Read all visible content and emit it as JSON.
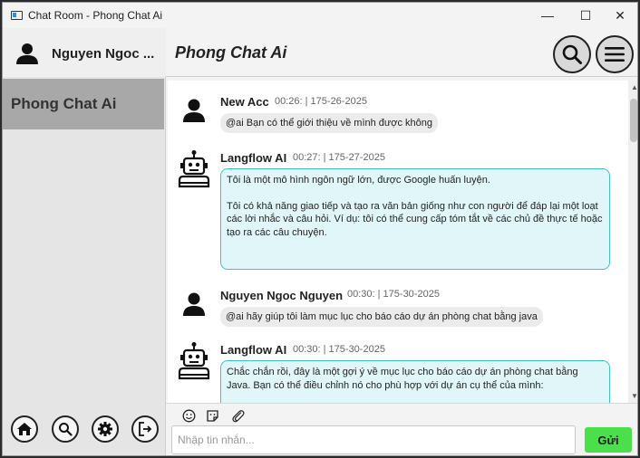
{
  "window": {
    "title": "Chat Room - Phong Chat Ai",
    "controls": {
      "minimize": "—",
      "maximize": "☐",
      "close": "✕"
    }
  },
  "sidebar": {
    "user_name": "Nguyen Ngoc ...",
    "rooms": [
      {
        "label": "Phong Chat Ai",
        "selected": true
      }
    ],
    "bottom_icons": [
      "home-icon",
      "search-icon",
      "gear-icon",
      "logout-icon"
    ]
  },
  "header": {
    "room_title": "Phong Chat Ai",
    "icons": [
      "search-icon",
      "menu-icon"
    ]
  },
  "messages": [
    {
      "sender": "New Acc",
      "time": "00:26: | 175-26-2025",
      "type": "user",
      "text": "@ai Bạn có thể giới thiệu về mình được không"
    },
    {
      "sender": "Langflow AI",
      "time": "00:27: | 175-27-2025",
      "type": "ai",
      "paragraphs": [
        "Tôi là một mô hình ngôn ngữ lớn, được Google huấn luyện.",
        "Tôi có khả năng giao tiếp và tạo ra văn bản giống như con người để đáp lại một loạt các lời nhắc và câu hỏi. Ví dụ: tôi có thể cung cấp tóm tắt về các chủ đề thực tế hoặc tạo ra các câu chuyện."
      ]
    },
    {
      "sender": "Nguyen Ngoc Nguyen",
      "time": "00:30: | 175-30-2025",
      "type": "user",
      "text": "@ai hãy giúp tôi làm mục lục cho báo cáo dự án phòng chat bằng java"
    },
    {
      "sender": "Langflow AI",
      "time": "00:30: | 175-30-2025",
      "type": "ai",
      "paragraphs": [
        "Chắc chắn rồi, đây là một gợi ý về mục lục cho báo cáo dự án phòng chat bằng Java. Bạn có thể điều chỉnh nó cho phù hợp với dự án cụ thể của mình:"
      ]
    }
  ],
  "composer": {
    "placeholder": "Nhập tin nhắn...",
    "value": "",
    "send_label": "Gửi",
    "tools": [
      "emoji-icon",
      "sticker-icon",
      "paperclip-icon"
    ]
  }
}
